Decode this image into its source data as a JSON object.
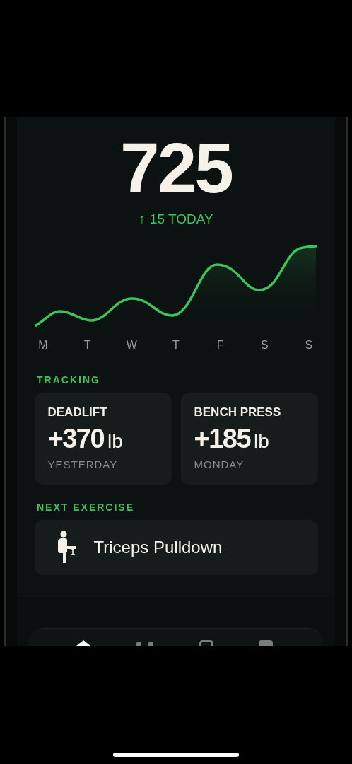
{
  "score": {
    "value": "725",
    "change_arrow": "↑",
    "change": "15 TODAY"
  },
  "chart": {
    "days": [
      "M",
      "T",
      "W",
      "T",
      "F",
      "S",
      "S"
    ]
  },
  "tracking": {
    "heading": "TRACKING",
    "cards": [
      {
        "name": "DEADLIFT",
        "amount": "+370",
        "unit": "lb",
        "when": "YESTERDAY"
      },
      {
        "name": "BENCH PRESS",
        "amount": "+185",
        "unit": "lb",
        "when": "MONDAY"
      }
    ]
  },
  "next_exercise": {
    "heading": "NEXT EXERCISE",
    "name": "Triceps Pulldown"
  },
  "tab_bar": {
    "tabs": [
      {
        "selected": true
      },
      {
        "selected": false
      },
      {
        "selected": false
      },
      {
        "selected": false
      }
    ]
  }
}
